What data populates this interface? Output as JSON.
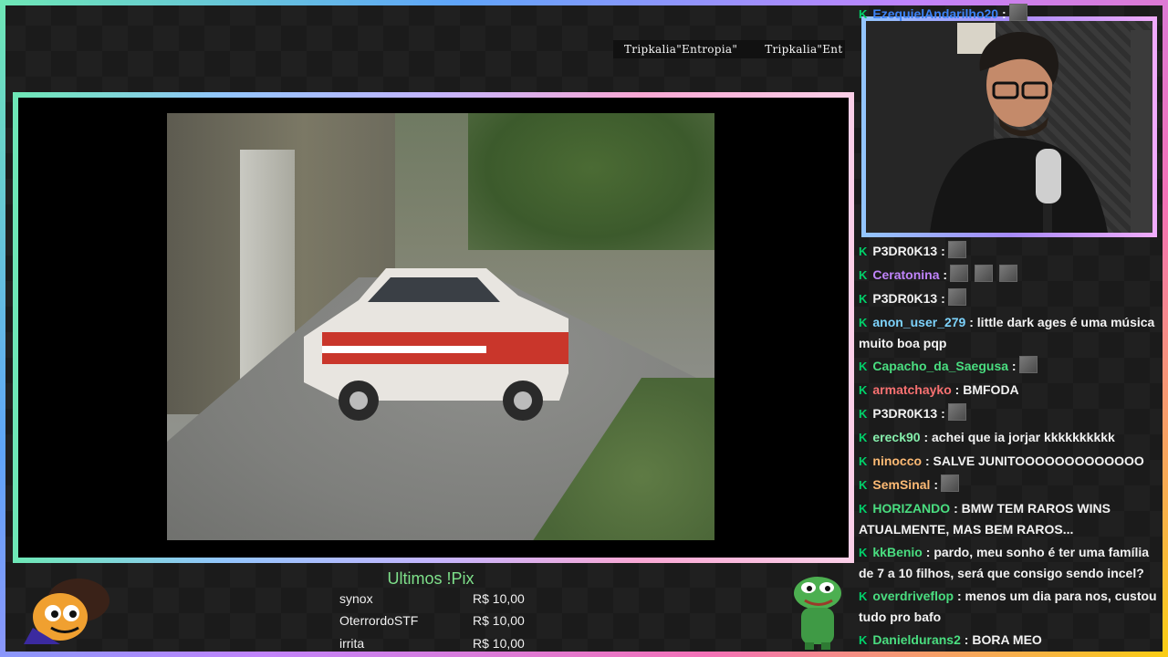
{
  "ticker": {
    "text1": "Tripkalia\"Entropia\"",
    "text2": "Tripkalia\"Ent"
  },
  "pix": {
    "title": "Ultimos !Pix",
    "entries": [
      {
        "name": "synox",
        "amount": "R$ 10,00"
      },
      {
        "name": "OterrordoSTF",
        "amount": "R$ 10,00"
      },
      {
        "name": "irrita",
        "amount": "R$ 10,00"
      }
    ]
  },
  "chat": {
    "badge": "K",
    "messages": [
      {
        "user": "EzequielAndarilho20",
        "sep": ":",
        "text": "",
        "emotes": 1,
        "color": "#3b82f6"
      },
      {
        "user": "P3DR0K13",
        "sep": ":",
        "text": "",
        "emotes": 1,
        "color": "#f2f2f2"
      },
      {
        "user": "Ceratonina",
        "sep": ":",
        "text": "",
        "emotes": 3,
        "color": "#c084fc"
      },
      {
        "user": "P3DR0K13",
        "sep": ":",
        "text": "",
        "emotes": 1,
        "color": "#f2f2f2"
      },
      {
        "user": "anon_user_279",
        "sep": ":",
        "text": "little dark ages é uma música muito boa pqp",
        "emotes": 0,
        "color": "#7dd3fc"
      },
      {
        "user": "Capacho_da_Saegusa",
        "sep": ":",
        "text": "",
        "emotes": 1,
        "color": "#4ade80"
      },
      {
        "user": "armatchayko",
        "sep": ":",
        "text": "BMFODA",
        "emotes": 0,
        "color": "#f87171"
      },
      {
        "user": "P3DR0K13",
        "sep": ":",
        "text": "",
        "emotes": 1,
        "color": "#f2f2f2"
      },
      {
        "user": "ereck90",
        "sep": ":",
        "text": "achei que ia jorjar kkkkkkkkkk",
        "emotes": 0,
        "color": "#86efac"
      },
      {
        "user": "ninocco",
        "sep": ":",
        "text": "SALVE JUNITOOOOOOOOOOOOO",
        "emotes": 0,
        "color": "#fdba74"
      },
      {
        "user": "SemSinal",
        "sep": ":",
        "text": "",
        "emotes": 1,
        "color": "#fdba74"
      },
      {
        "user": "HORIZANDO",
        "sep": ":",
        "text": "BMW TEM RAROS WINS ATUALMENTE, MAS BEM RAROS...",
        "emotes": 0,
        "color": "#4ade80"
      },
      {
        "user": "kkBenio",
        "sep": ":",
        "text": "pardo, meu sonho é ter uma família de 7 a 10 filhos, será que consigo sendo incel?",
        "emotes": 0,
        "color": "#4ade80"
      },
      {
        "user": "overdriveflop",
        "sep": ":",
        "text": "menos um dia para nos, custou tudo pro bafo",
        "emotes": 0,
        "color": "#4ade80"
      },
      {
        "user": "Danieldurans2",
        "sep": ":",
        "text": "BORA MEO",
        "emotes": 0,
        "color": "#4ade80"
      }
    ]
  },
  "colors": {
    "pix_title": "#7ee08a",
    "chat_badge": "#00d26a",
    "frame_gradient": [
      "#6ee7b7",
      "#60a5fa",
      "#c084fc",
      "#f472b6",
      "#facc15"
    ]
  },
  "icons": {
    "badge": "kick-k-icon",
    "emote": "emote-icon",
    "mascot_left": "cartoon-mascot-icon",
    "mascot_right": "pepe-frog-icon"
  }
}
